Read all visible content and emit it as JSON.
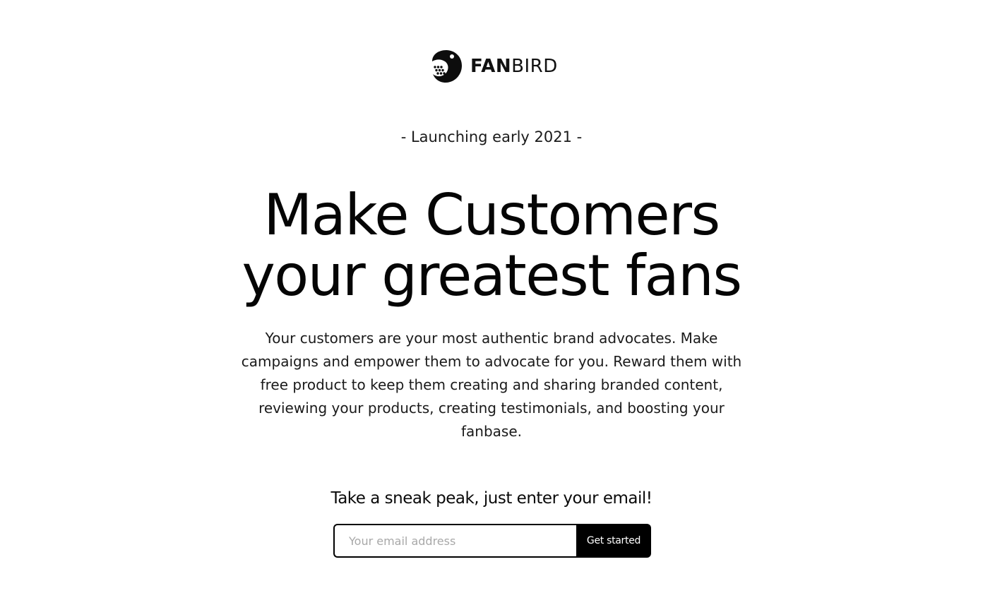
{
  "brand": {
    "name_bold": "FAN",
    "name_light": "BIRD",
    "logo_icon": "bird-icon"
  },
  "hero": {
    "tagline": "- Launching early 2021 -",
    "headline": "Make Customers your greatest fans",
    "description": "Your customers are your most authentic brand advocates. Make campaigns and empower them to advocate for you. Reward them with free product to keep them creating and sharing branded content, reviewing your products, creating testimonials, and boosting your fanbase."
  },
  "signup": {
    "heading": "Take a sneak peak, just enter your email!",
    "email_placeholder": "Your email address",
    "email_value": "",
    "button_label": "Get started"
  },
  "colors": {
    "background": "#ffffff",
    "text": "#0c0c0c",
    "button": "#000000",
    "button_text": "#ffffff",
    "placeholder": "#a8a8a8"
  }
}
